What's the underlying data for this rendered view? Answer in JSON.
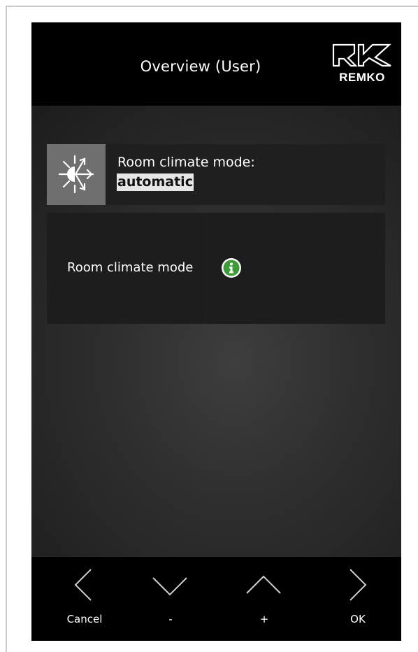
{
  "header": {
    "title": "Overview (User)",
    "logo_text": "REMKO"
  },
  "status": {
    "label": "Room climate mode:",
    "value": "automatic",
    "icon": "snowflake-sun-icon"
  },
  "menu": {
    "item_label": "Room climate mode",
    "info_icon": "info-icon",
    "info_color": "#3f9b3a"
  },
  "footer": {
    "buttons": [
      {
        "label": "Cancel",
        "icon": "chevron-left-icon"
      },
      {
        "label": "-",
        "icon": "chevron-down-icon"
      },
      {
        "label": "+",
        "icon": "chevron-up-icon"
      },
      {
        "label": "OK",
        "icon": "chevron-right-icon"
      }
    ]
  }
}
